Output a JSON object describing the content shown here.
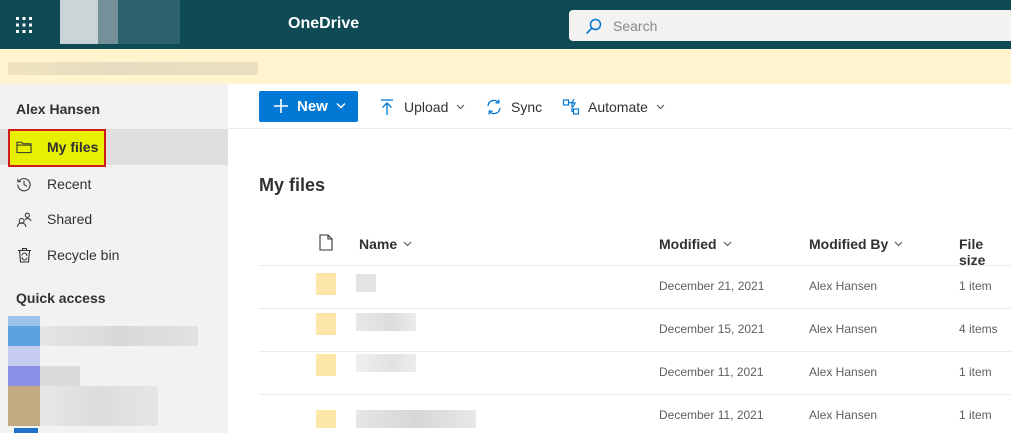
{
  "app": {
    "name": "OneDrive"
  },
  "search": {
    "placeholder": "Search"
  },
  "sidebar": {
    "user_name": "Alex Hansen",
    "items": [
      {
        "label": "My files",
        "icon": "folder-icon"
      },
      {
        "label": "Recent",
        "icon": "history-icon"
      },
      {
        "label": "Shared",
        "icon": "people-icon"
      },
      {
        "label": "Recycle bin",
        "icon": "trash-icon"
      }
    ],
    "quick_access_label": "Quick access"
  },
  "toolbar": {
    "new_label": "New",
    "upload_label": "Upload",
    "sync_label": "Sync",
    "automate_label": "Automate"
  },
  "main": {
    "title": "My files",
    "columns": [
      "Name",
      "Modified",
      "Modified By",
      "File size"
    ],
    "rows": [
      {
        "modified": "December 21, 2021",
        "modified_by": "Alex Hansen",
        "file_size": "1 item"
      },
      {
        "modified": "December 15, 2021",
        "modified_by": "Alex Hansen",
        "file_size": "4 items"
      },
      {
        "modified": "December 11, 2021",
        "modified_by": "Alex Hansen",
        "file_size": "1 item"
      },
      {
        "modified": "December 11, 2021",
        "modified_by": "Alex Hansen",
        "file_size": "1 item"
      }
    ]
  },
  "colors": {
    "suite_bar": "#0f4b55",
    "brand_blue": "#0078d4",
    "banner": "#fff4ce",
    "sidebar_bg": "#f3f2f1",
    "annotation_fill": "#e6f000",
    "annotation_border": "#d11a1a"
  }
}
